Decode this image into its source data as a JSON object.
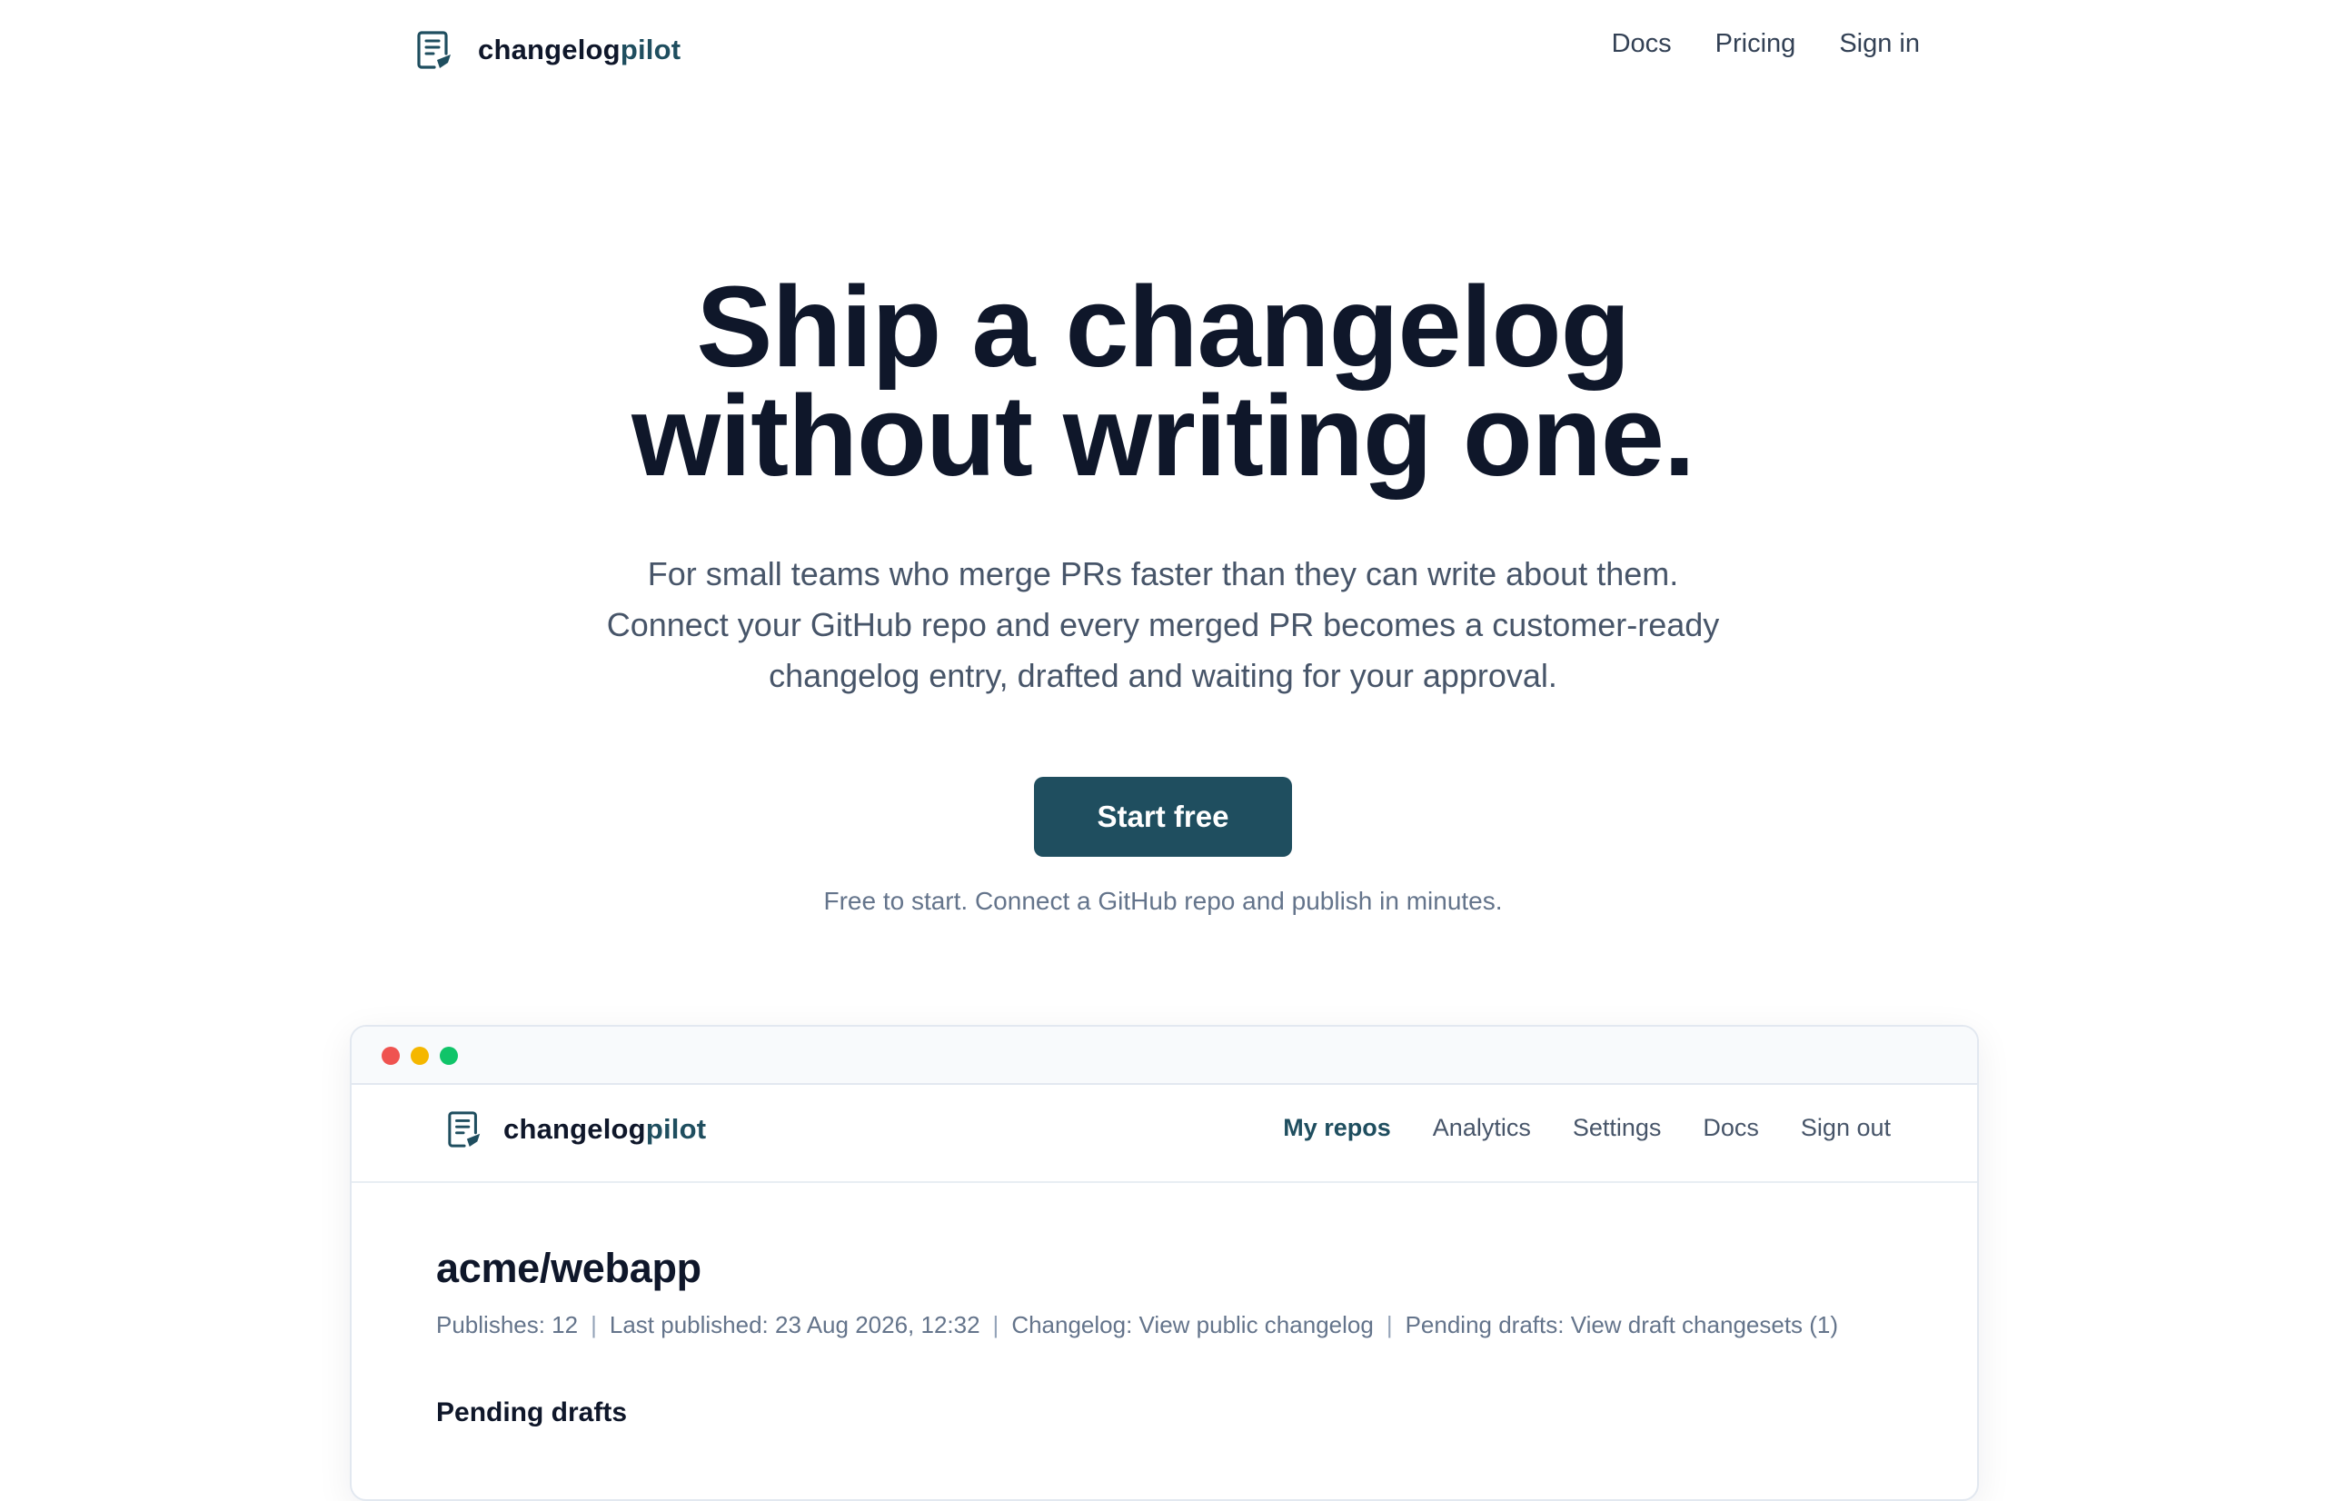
{
  "brand": {
    "name_part1": "changelog",
    "name_part2": "pilot",
    "icon": "document-pen-icon",
    "color": "#1f4e5f"
  },
  "nav": {
    "docs": "Docs",
    "pricing": "Pricing",
    "sign_in": "Sign in"
  },
  "hero": {
    "title_line1": "Ship a changelog",
    "title_line2": "without writing one.",
    "sub_line1": "For small teams who merge PRs faster than they can write about them.",
    "sub_line2": "Connect your GitHub repo and every merged PR becomes a customer-ready",
    "sub_line3": "changelog entry, drafted and waiting for your approval.",
    "cta": "Start free",
    "note": "Free to start. Connect a GitHub repo and publish in minutes."
  },
  "preview": {
    "window_dots": [
      "#ef5350",
      "#f5b700",
      "#10c469"
    ],
    "nav": {
      "my_repos": "My repos",
      "analytics": "Analytics",
      "settings": "Settings",
      "docs": "Docs",
      "sign_out": "Sign out"
    },
    "repo": "acme/webapp",
    "meta": {
      "publishes": "Publishes: 12",
      "last_published": "Last published: 23 Aug 2026, 12:32",
      "changelog_label": "Changelog: ",
      "changelog_link": "View public changelog",
      "drafts_label": "Pending drafts: ",
      "drafts_link": "View draft changesets (1)",
      "separator": "|"
    },
    "section_title": "Pending drafts"
  }
}
